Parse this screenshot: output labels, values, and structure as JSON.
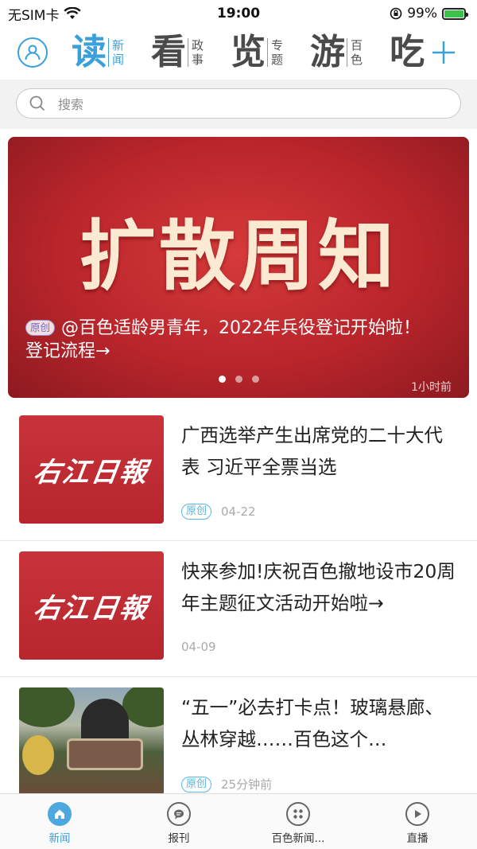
{
  "status_bar": {
    "carrier": "无SIM卡",
    "time": "19:00",
    "battery_percent": "99%",
    "battery_level": 0.99
  },
  "nav": {
    "channels": [
      {
        "big": "读",
        "small1": "新",
        "small2": "闻",
        "active": true
      },
      {
        "big": "看",
        "small1": "政",
        "small2": "事",
        "active": false
      },
      {
        "big": "览",
        "small1": "专",
        "small2": "题",
        "active": false
      },
      {
        "big": "游",
        "small1": "百",
        "small2": "色",
        "active": false
      },
      {
        "big": "吃",
        "small1": "",
        "small2": "",
        "active": false
      }
    ],
    "accent_color": "#3aa0dc"
  },
  "search": {
    "placeholder": "搜索"
  },
  "banner": {
    "headline": "扩散周知",
    "tag": "原创",
    "caption": "@百色适龄男青年，2022年兵役登记开始啦！登记流程→",
    "time": "1小时前",
    "dots": 3,
    "active_dot": 0
  },
  "news": [
    {
      "title": "广西选举产生出席党的二十大代表 习近平全票当选",
      "tag": "原创",
      "date": "04-22",
      "thumb_text": "右江日報"
    },
    {
      "title": "快来参加!庆祝百色撤地设市20周年主题征文活动开始啦→",
      "tag": "",
      "date": "04-09",
      "thumb_text": "右江日報"
    },
    {
      "title": "“五一”必去打卡点！玻璃悬廊、丛林穿越……百色这个…",
      "tag": "原创",
      "date": "25分钟前",
      "thumb_text": ""
    }
  ],
  "tabs": [
    {
      "label": "新闻",
      "icon": "home-icon",
      "active": true
    },
    {
      "label": "报刊",
      "icon": "chat-icon",
      "active": false
    },
    {
      "label": "百色新闻...",
      "icon": "grid-icon",
      "active": false
    },
    {
      "label": "直播",
      "icon": "play-icon",
      "active": false
    }
  ]
}
